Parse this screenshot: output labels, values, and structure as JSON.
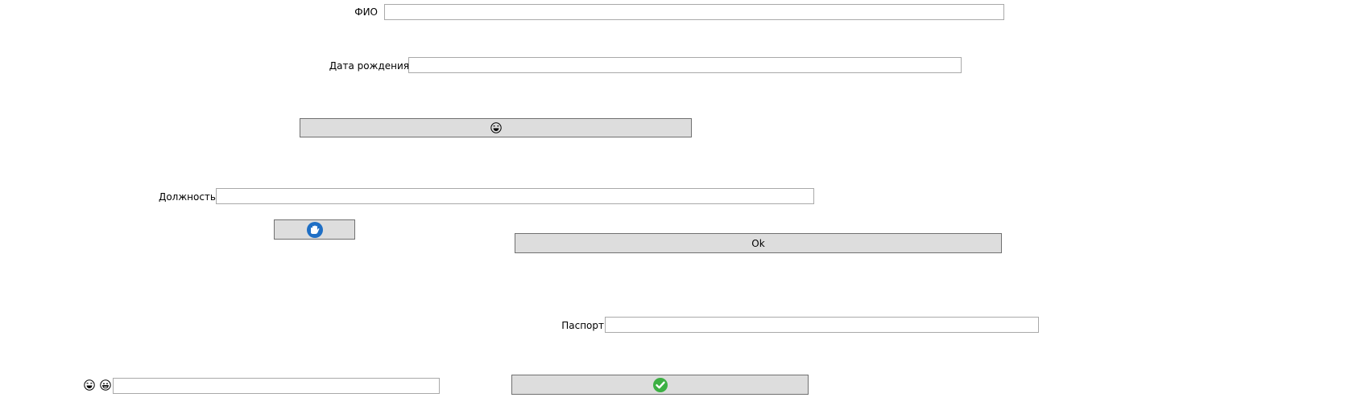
{
  "form": {
    "fio_label": "ФИО",
    "fio_value": "",
    "birth_label": "Дата рождения",
    "birth_value": "",
    "position_label": "Должность",
    "position_value": "",
    "passport_label": "Паспорт",
    "passport_value": "",
    "bottom_value": "",
    "ok_label": "Ok"
  },
  "icons": {
    "emoji_button_icon": "laughing-face-icon",
    "hand_button_icon": "blue-hand-icon",
    "confirm_button_icon": "green-check-icon",
    "bottom_left_icons": [
      "laughing-face-icon",
      "grinning-face-icon"
    ]
  },
  "colors": {
    "button_bg": "#dddddd",
    "field_border": "#a9a9a9",
    "button_border": "#707070",
    "hand_blue": "#1f6fc5",
    "check_green": "#3cb043"
  }
}
